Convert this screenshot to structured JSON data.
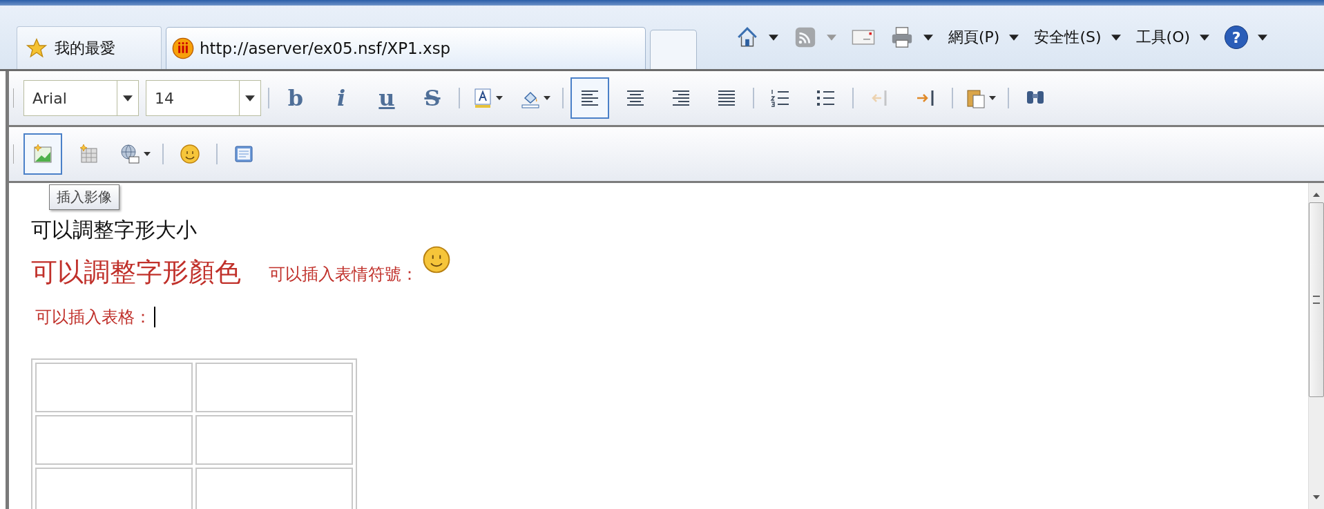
{
  "favorites": {
    "label": "我的最愛"
  },
  "tab": {
    "title": "http://aserver/ex05.nsf/XP1.xsp"
  },
  "commands": [
    {
      "kind": "home",
      "dropdown": true,
      "disabled": false
    },
    {
      "kind": "feed",
      "dropdown": true,
      "disabled": true
    },
    {
      "kind": "mail",
      "dropdown": false,
      "disabled": false
    },
    {
      "kind": "print",
      "dropdown": true,
      "disabled": false
    },
    {
      "kind": "menu",
      "label": "網頁(P)",
      "dropdown": true,
      "disabled": false
    },
    {
      "kind": "menu",
      "label": "安全性(S)",
      "dropdown": true,
      "disabled": false
    },
    {
      "kind": "menu",
      "label": "工具(O)",
      "dropdown": true,
      "disabled": false
    },
    {
      "kind": "help",
      "label": "?",
      "dropdown": true,
      "disabled": false
    }
  ],
  "toolbars": [
    {
      "items": [
        {
          "kind": "select",
          "value": "Arial"
        },
        {
          "kind": "select",
          "value": "14"
        },
        {
          "kind": "separator"
        },
        {
          "kind": "bold",
          "label": "b",
          "selected": false,
          "disabled": false,
          "dropdown": false
        },
        {
          "kind": "italic",
          "label": "i",
          "selected": false,
          "disabled": false,
          "dropdown": false
        },
        {
          "kind": "underline",
          "label": "u",
          "selected": false,
          "disabled": false,
          "dropdown": false
        },
        {
          "kind": "strike",
          "label": "S",
          "selected": false,
          "disabled": false,
          "dropdown": false
        },
        {
          "kind": "separator"
        },
        {
          "kind": "textcolor",
          "selected": false,
          "disabled": false,
          "dropdown": true
        },
        {
          "kind": "fillcolor",
          "selected": false,
          "disabled": false,
          "dropdown": true
        },
        {
          "kind": "separator"
        },
        {
          "kind": "alignleft",
          "selected": true,
          "disabled": false,
          "dropdown": false
        },
        {
          "kind": "aligncenter",
          "selected": false,
          "disabled": false,
          "dropdown": false
        },
        {
          "kind": "alignright",
          "selected": false,
          "disabled": false,
          "dropdown": false
        },
        {
          "kind": "justify",
          "selected": false,
          "disabled": false,
          "dropdown": false
        },
        {
          "kind": "separator"
        },
        {
          "kind": "numbered",
          "selected": false,
          "disabled": false,
          "dropdown": false
        },
        {
          "kind": "bulleted",
          "selected": false,
          "disabled": false,
          "dropdown": false
        },
        {
          "kind": "separator"
        },
        {
          "kind": "outdent",
          "selected": false,
          "disabled": true,
          "dropdown": false
        },
        {
          "kind": "indent",
          "selected": false,
          "disabled": false,
          "dropdown": false
        },
        {
          "kind": "separator"
        },
        {
          "kind": "paste",
          "selected": false,
          "disabled": false,
          "dropdown": true
        },
        {
          "kind": "separator"
        },
        {
          "kind": "find",
          "selected": false,
          "disabled": false,
          "dropdown": false
        }
      ]
    },
    {
      "items": [
        {
          "kind": "image",
          "selected": true,
          "disabled": false,
          "dropdown": false
        },
        {
          "kind": "table",
          "selected": false,
          "disabled": false,
          "dropdown": false
        },
        {
          "kind": "link",
          "selected": false,
          "disabled": false,
          "dropdown": true
        },
        {
          "kind": "separator"
        },
        {
          "kind": "emoticon",
          "selected": false,
          "disabled": false,
          "dropdown": false
        },
        {
          "kind": "separator"
        },
        {
          "kind": "form",
          "selected": false,
          "disabled": false,
          "dropdown": false
        }
      ]
    }
  ],
  "tooltip": {
    "text": "插入影像"
  },
  "content": {
    "line_1": "可以調整字形大小",
    "line_2": "可以調整字形顏色",
    "line_2_note": "可以插入表情符號：",
    "line_3": "可以插入表格："
  }
}
